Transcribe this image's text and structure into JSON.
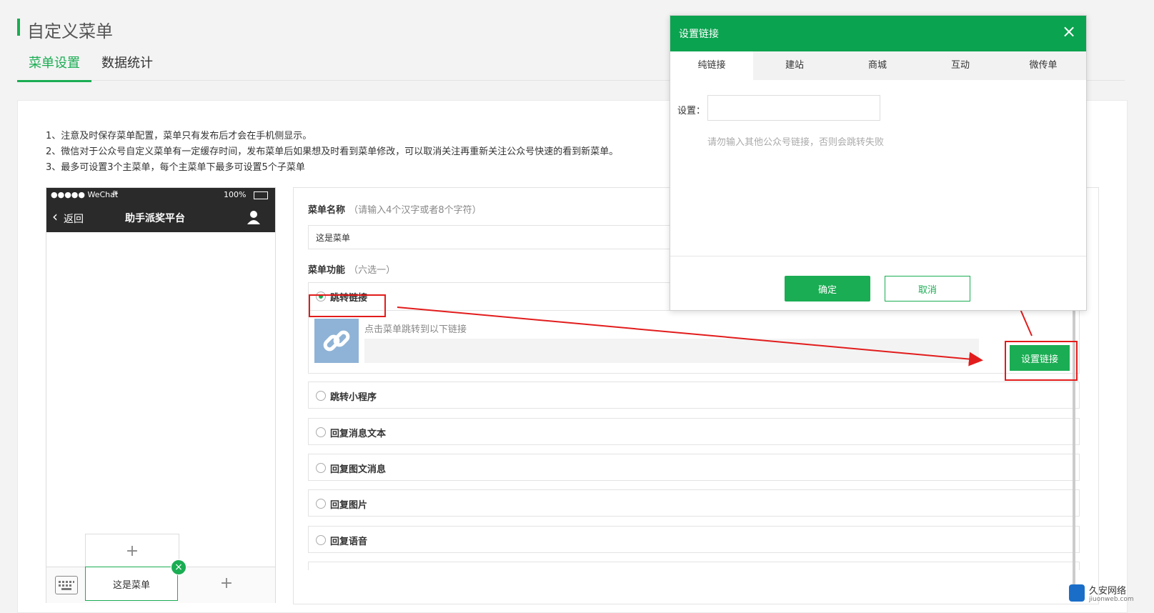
{
  "page": {
    "title": "自定义菜单",
    "tabs": [
      "菜单设置",
      "数据统计"
    ],
    "notes": [
      "1、注意及时保存菜单配置，菜单只有发布后才会在手机侧显示。",
      "2、微信对于公众号自定义菜单有一定缓存时间，发布菜单后如果想及时看到菜单修改，可以取消关注再重新关注公众号快速的看到新菜单。",
      "3、最多可设置3个主菜单，每个主菜单下最多可设置5个子菜单"
    ]
  },
  "phone": {
    "carrier": "●●●●● WeChat",
    "battery": "100%",
    "back": "返回",
    "nav_title": "助手派奖平台",
    "sub_add": "+",
    "menu_current": "这是菜单",
    "menu_add": "+"
  },
  "editor": {
    "name_label": "菜单名称",
    "name_hint": "（请输入4个汉字或者8个字符）",
    "name_value": "这是菜单",
    "func_label": "菜单功能",
    "func_hint": "（六选一）",
    "options": [
      "跳转链接",
      "跳转小程序",
      "回复消息文本",
      "回复图文消息",
      "回复图片",
      "回复语音"
    ],
    "link_desc": "点击菜单跳转到以下链接",
    "set_link_button": "设置链接"
  },
  "modal": {
    "title": "设置链接",
    "close": "×",
    "tabs": [
      "纯链接",
      "建站",
      "商城",
      "互动",
      "微传单"
    ],
    "field_label": "设置：",
    "field_value": "",
    "field_hint": "请勿输入其他公众号链接，否则会跳转失败",
    "ok": "确定",
    "cancel": "取消"
  },
  "watermark": {
    "text_cn": "久安网络",
    "text_en": "jiuonweb.com"
  },
  "colors": {
    "brand_green": "#1aad53",
    "header_green": "#0aa34f",
    "annotation_red": "#e21c1c"
  }
}
